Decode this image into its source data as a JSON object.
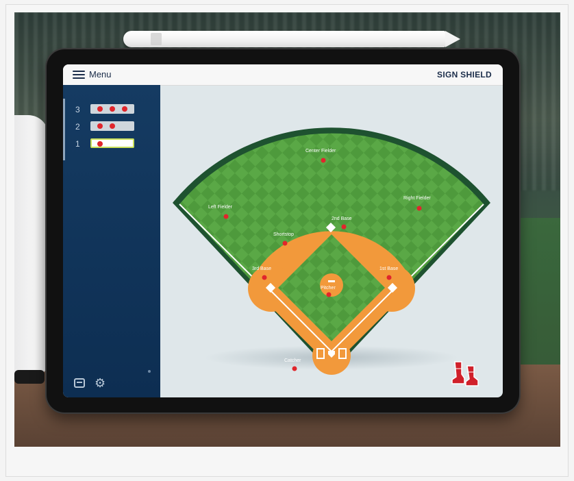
{
  "topbar": {
    "menu_label": "Menu",
    "brand": "SIGN SHIELD"
  },
  "outs": [
    {
      "number": "3",
      "dots": 3,
      "active": false
    },
    {
      "number": "2",
      "dots": 2,
      "active": false
    },
    {
      "number": "1",
      "dots": 1,
      "active": true
    }
  ],
  "positions": {
    "center_fielder": "Center Fielder",
    "left_fielder": "Left Fielder",
    "right_fielder": "Right Fielder",
    "second_base": "2nd Base",
    "shortstop": "Shortstop",
    "third_base": "3rd Base",
    "first_base": "1st Base",
    "pitcher": "Pitcher",
    "catcher": "Catcher"
  },
  "icons": {
    "menu": "hamburger-icon",
    "sidebar_1": "window-icon",
    "sidebar_2": "gear-icon",
    "logo": "red-sox-logo"
  },
  "colors": {
    "sidebar": "#153b62",
    "grass": "#4e9a3c",
    "infield_dirt": "#f2993b",
    "marker": "#e0262c"
  }
}
